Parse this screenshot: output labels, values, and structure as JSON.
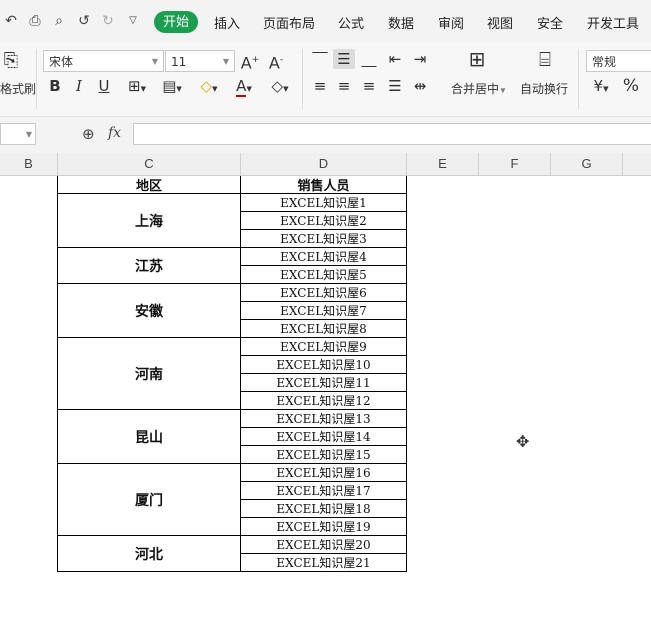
{
  "menubar": {
    "quick_access": [
      "undo-icon",
      "print-icon",
      "print-preview-icon",
      "undo-arrow-icon",
      "redo-arrow-icon",
      "more-icon"
    ],
    "tabs": [
      "开始",
      "插入",
      "页面布局",
      "公式",
      "数据",
      "审阅",
      "视图",
      "安全",
      "开发工具"
    ],
    "active_tab": "开始",
    "accent_color": "#1a9e50"
  },
  "ribbon": {
    "format_painter_label": "格式刷",
    "font_name": "宋体",
    "font_size": "11",
    "merge_center_label": "合并居中",
    "wrap_text_label": "自动换行",
    "number_format": "常规",
    "percent_symbol": "%"
  },
  "formula_bar": {
    "fx_label": "fx",
    "value": ""
  },
  "columns": [
    "B",
    "C",
    "D",
    "E",
    "F",
    "G"
  ],
  "table": {
    "headers": [
      "地区",
      "销售人员"
    ],
    "groups": [
      {
        "region": "上海",
        "people": [
          "EXCEL知识屋1",
          "EXCEL知识屋2",
          "EXCEL知识屋3"
        ]
      },
      {
        "region": "江苏",
        "people": [
          "EXCEL知识屋4",
          "EXCEL知识屋5"
        ]
      },
      {
        "region": "安徽",
        "people": [
          "EXCEL知识屋6",
          "EXCEL知识屋7",
          "EXCEL知识屋8"
        ]
      },
      {
        "region": "河南",
        "people": [
          "EXCEL知识屋9",
          "EXCEL知识屋10",
          "EXCEL知识屋11",
          "EXCEL知识屋12"
        ]
      },
      {
        "region": "昆山",
        "people": [
          "EXCEL知识屋13",
          "EXCEL知识屋14",
          "EXCEL知识屋15"
        ]
      },
      {
        "region": "厦门",
        "people": [
          "EXCEL知识屋16",
          "EXCEL知识屋17",
          "EXCEL知识屋18",
          "EXCEL知识屋19"
        ]
      },
      {
        "region": "河北",
        "people": [
          "EXCEL知识屋20",
          "EXCEL知识屋21"
        ]
      }
    ]
  }
}
